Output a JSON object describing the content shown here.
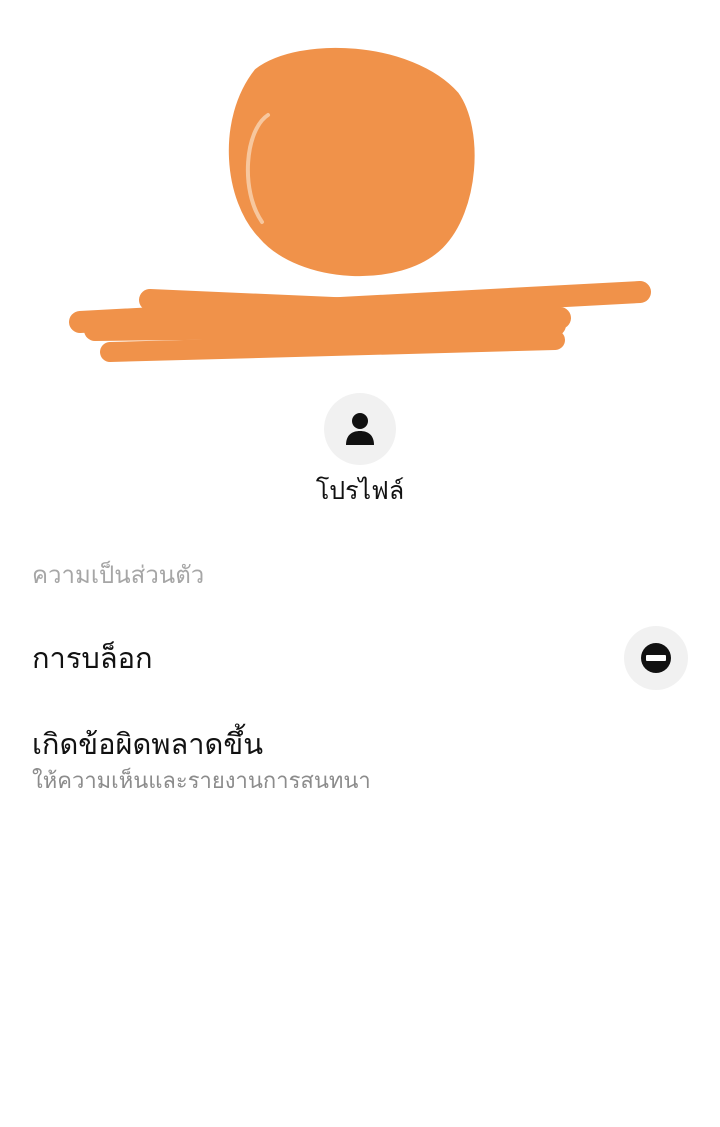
{
  "profile": {
    "redacted_area_color": "#f0924a",
    "action": {
      "icon": "person-icon",
      "label": "โปรไฟล์"
    }
  },
  "privacy": {
    "section_title": "ความเป็นส่วนตัว",
    "block": {
      "label": "การบล็อก",
      "icon": "no-entry-icon"
    },
    "report": {
      "title": "เกิดข้อผิดพลาดขึ้น",
      "subtitle": "ให้ความเห็นและรายงานการสนทนา"
    }
  }
}
